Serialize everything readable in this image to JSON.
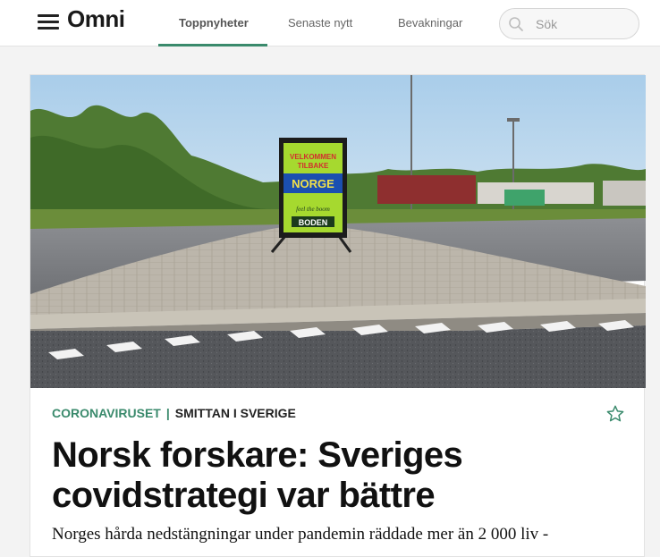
{
  "header": {
    "logo": "Omni",
    "tabs": [
      {
        "label": "Toppnyheter",
        "active": true
      },
      {
        "label": "Senaste nytt",
        "active": false
      },
      {
        "label": "Bevakningar",
        "active": false
      }
    ],
    "search": {
      "placeholder": "Sök"
    }
  },
  "article": {
    "category": "CORONAVIRUSET",
    "separator": "|",
    "topic": "SMITTAN I SVERIGE",
    "headline": "Norsk forskare: Sveriges covidstrategi var bättre",
    "lede": "Norges hårda nedstängningar under pandemin räddade mer än 2 000 liv -",
    "image": {
      "sign_line1": "VELKOMMEN",
      "sign_line2": "TILBAKE",
      "sign_line3": "NORGE",
      "sign_line4": "feel the boom",
      "sign_line5": "BODEN"
    }
  },
  "colors": {
    "accent": "#3a8a6c",
    "headline": "#111111",
    "sign_green": "#a6d92f",
    "sign_blue": "#1b4fb0"
  }
}
